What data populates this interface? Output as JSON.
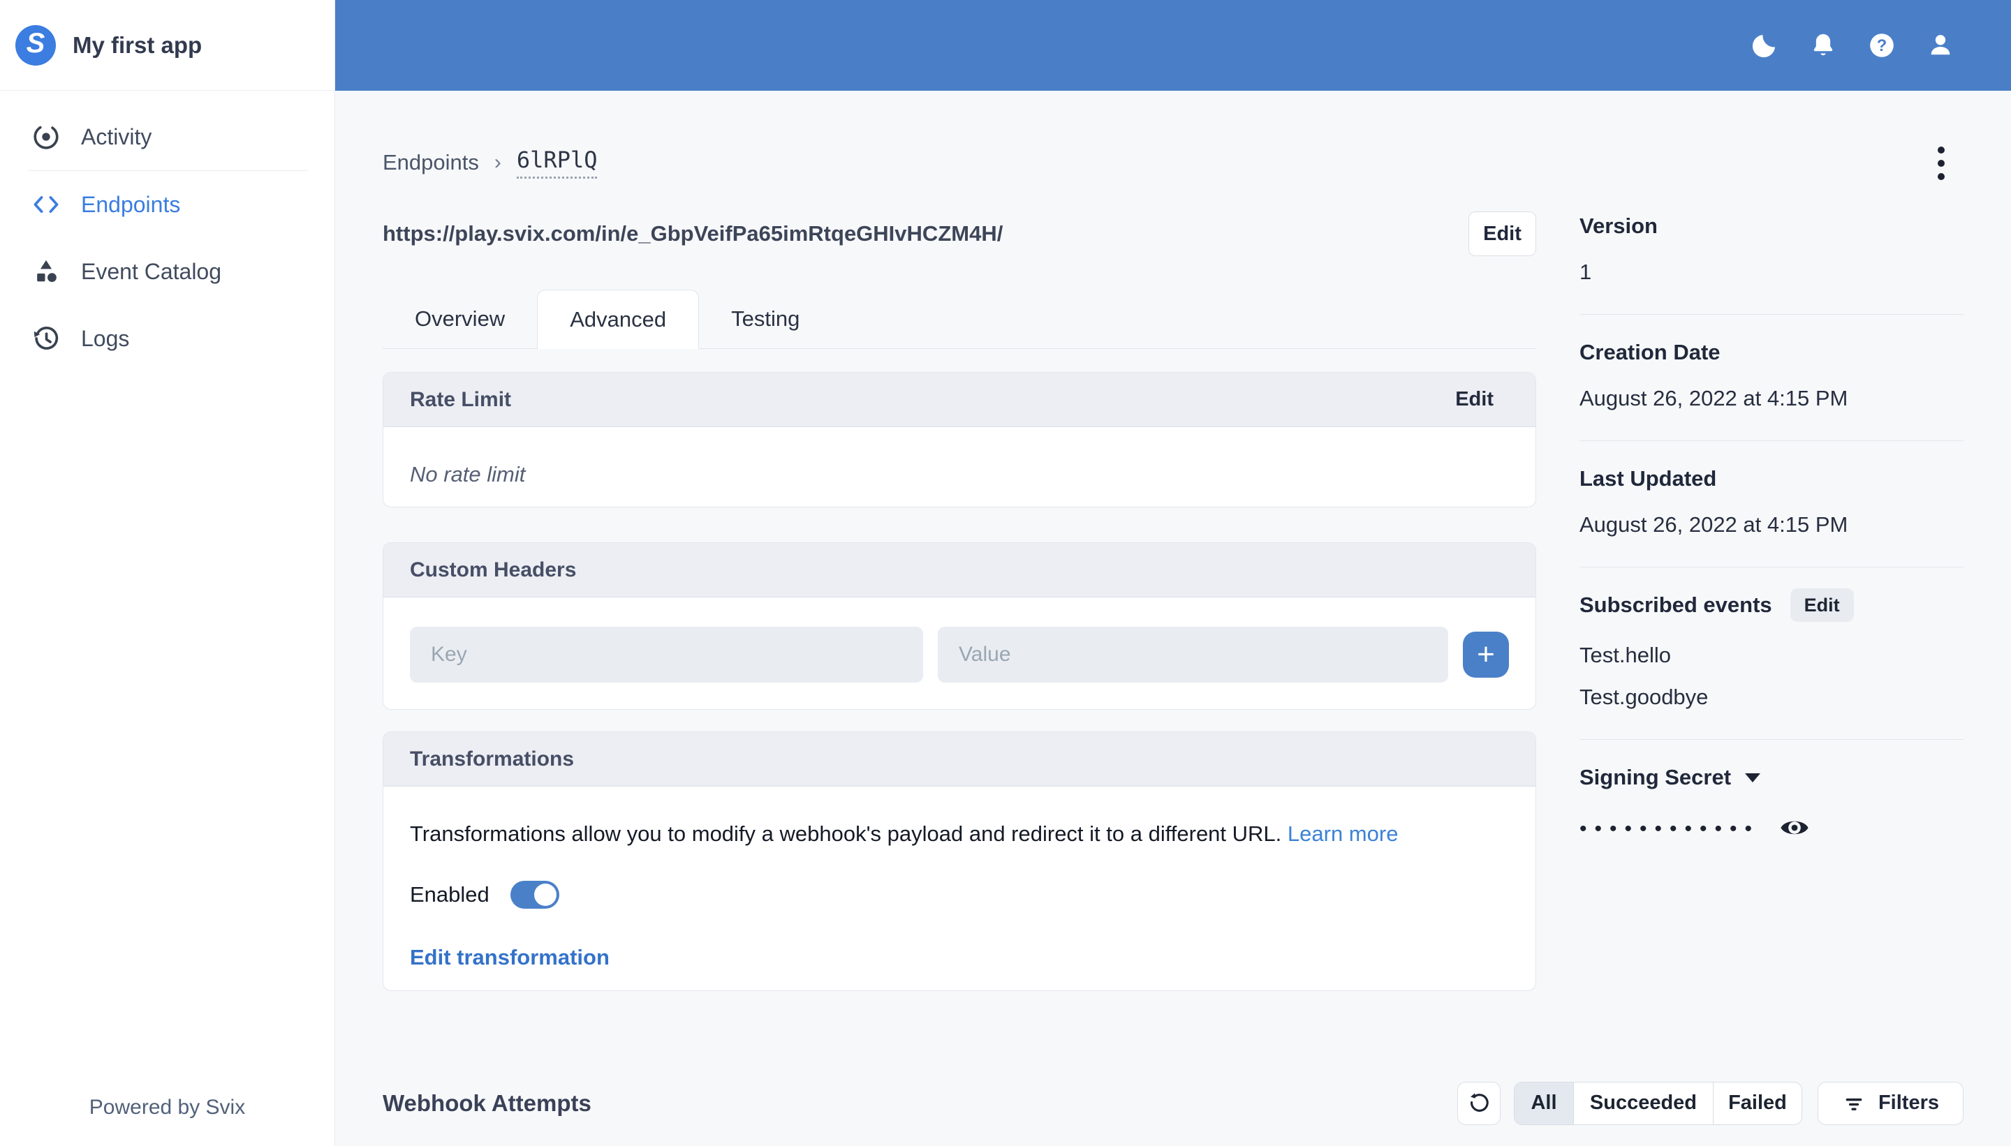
{
  "colors": {
    "topbar_blue": "#4a7fc8",
    "brand_blue": "#3b7de0",
    "link_blue": "#3b82d8",
    "toggle_on_blue": "#4a80c8",
    "page_bg": "#f7f8fa",
    "card_header_bg": "#eceef3",
    "segment_active_bg": "#e3e9ef"
  },
  "sidebar": {
    "app_name": "My first app",
    "items": [
      {
        "label": "Activity",
        "icon": "activity-icon",
        "active": false
      },
      {
        "label": "Endpoints",
        "icon": "endpoints-icon",
        "active": true
      },
      {
        "label": "Event Catalog",
        "icon": "event-catalog-icon",
        "active": false
      },
      {
        "label": "Logs",
        "icon": "logs-icon",
        "active": false
      }
    ],
    "footer": "Powered by Svix"
  },
  "topbar": {
    "icons": [
      "moon-icon",
      "bell-icon",
      "help-icon",
      "user-icon"
    ]
  },
  "breadcrumb": {
    "parent": "Endpoints",
    "separator": "›",
    "current": "6lRPlQ"
  },
  "endpoint": {
    "url": "https://play.svix.com/in/e_GbpVeifPa65imRtqeGHIvHCZM4H/",
    "edit_label": "Edit"
  },
  "tabs": [
    {
      "label": "Overview",
      "active": false
    },
    {
      "label": "Advanced",
      "active": true
    },
    {
      "label": "Testing",
      "active": false
    }
  ],
  "cards": {
    "rate_limit": {
      "title": "Rate Limit",
      "edit_label": "Edit",
      "empty_text": "No rate limit"
    },
    "custom_headers": {
      "title": "Custom Headers",
      "key_placeholder": "Key",
      "value_placeholder": "Value",
      "add_label": "+"
    },
    "transformations": {
      "title": "Transformations",
      "description": "Transformations allow you to modify a webhook's payload and redirect it to a different URL.",
      "learn_more_label": "Learn more",
      "enabled_label": "Enabled",
      "toggle_state": "on",
      "edit_link_label": "Edit transformation"
    }
  },
  "details": {
    "version": {
      "label": "Version",
      "value": "1"
    },
    "creation_date": {
      "label": "Creation Date",
      "value": "August 26, 2022 at 4:15 PM"
    },
    "last_updated": {
      "label": "Last Updated",
      "value": "August 26, 2022 at 4:15 PM"
    },
    "subscribed_events": {
      "label": "Subscribed events",
      "edit_label": "Edit",
      "events": [
        "Test.hello",
        "Test.goodbye"
      ]
    },
    "signing_secret": {
      "label": "Signing Secret",
      "masked_value": "••••••••••••"
    }
  },
  "attempts": {
    "title": "Webhook Attempts",
    "filter_segments": [
      {
        "label": "All",
        "active": true
      },
      {
        "label": "Succeeded",
        "active": false
      },
      {
        "label": "Failed",
        "active": false
      }
    ],
    "filters_label": "Filters"
  }
}
